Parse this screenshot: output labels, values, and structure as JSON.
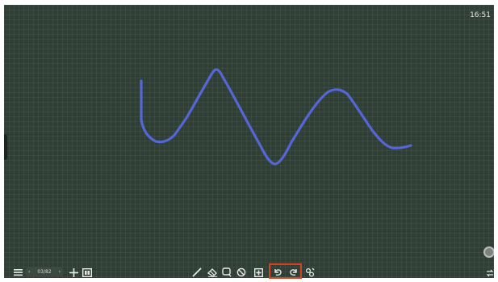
{
  "status_bar": {
    "time": "16:51"
  },
  "page_nav": {
    "prev_icon": "chevron-left-icon",
    "page_label": "03/82",
    "next_icon": "chevron-right-icon"
  },
  "toolbar_left": [
    "menu-icon",
    "add-page-icon",
    "page-overview-icon"
  ],
  "toolbar_center": [
    "pen-icon",
    "eraser-icon",
    "lasso-select-icon",
    "clear-icon",
    "insert-icon",
    "undo-icon",
    "redo-icon",
    "tools-icon"
  ],
  "toolbar_right": [
    "switch-side-icon"
  ],
  "colors": {
    "board": "#2f3f35",
    "stroke": "#5566d6",
    "icon": "#e8e8e8",
    "highlight_border": "#d9401f"
  },
  "drawing": {
    "stroke_count": 1,
    "stroke_color": "#5566d6"
  }
}
